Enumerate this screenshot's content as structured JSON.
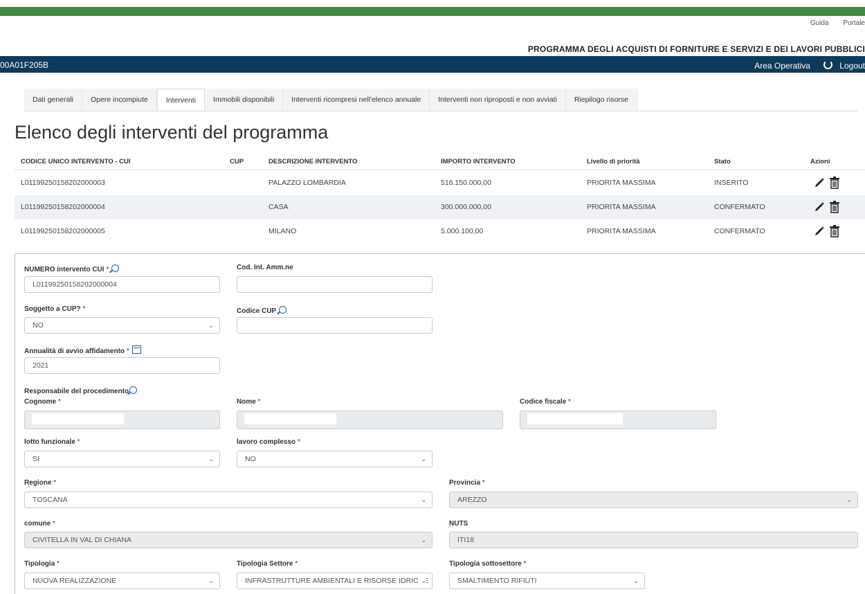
{
  "util_links": {
    "guida": "Guida",
    "portale": "Portale"
  },
  "header": {
    "program_title": "PROGRAMMA DEGLI ACQUISTI DI FORNITURE E SERVIZI E DEI LAVORI PUBBLICI"
  },
  "navbar": {
    "code": "00A01F205B",
    "area": "Area Operativa",
    "logout": "Logout"
  },
  "tabs": [
    {
      "label": "Dati generali"
    },
    {
      "label": "Opere incompiute"
    },
    {
      "label": "Interventi",
      "active": true
    },
    {
      "label": "Immobili disponibili"
    },
    {
      "label": "Interventi ricompresi nell'elenco annuale"
    },
    {
      "label": "Interventi non riproposti e non avviati"
    },
    {
      "label": "Riepilogo risorse"
    }
  ],
  "page_title": "Elenco degli interventi del programma",
  "table": {
    "headers": {
      "cui": "CODICE UNICO INTERVENTO - CUI",
      "cup": "CUP",
      "descrizione": "DESCRIZIONE INTERVENTO",
      "importo": "IMPORTO INTERVENTO",
      "priorita": "Livello di priorità",
      "stato": "Stato",
      "azioni": "Azioni"
    },
    "rows": [
      {
        "cui": "L01199250158202000003",
        "cup": "",
        "descrizione": "PALAZZO LOMBARDIA",
        "importo": "516.150.000,00",
        "priorita": "PRIORITA MASSIMA",
        "stato": "INSERITO"
      },
      {
        "cui": "L01199250158202000004",
        "cup": "",
        "descrizione": "CASA",
        "importo": "300.000.000,00",
        "priorita": "PRIORITA MASSIMA",
        "stato": "CONFERMATO"
      },
      {
        "cui": "L01199250158202000005",
        "cup": "",
        "descrizione": "MILANO",
        "importo": "5.000.100,00",
        "priorita": "PRIORITA MASSIMA",
        "stato": "CONFERMATO"
      }
    ]
  },
  "form": {
    "numero_cui": {
      "label": "NUMERO intervento CUI",
      "required": "*",
      "value": "L01199250158202000004"
    },
    "cod_int": {
      "label": "Cod. Int. Amm.ne",
      "value": ""
    },
    "soggetto_cup": {
      "label": "Soggetto a CUP?",
      "required": "*",
      "value": "NO"
    },
    "codice_cup": {
      "label": "Codice CUP",
      "value": ""
    },
    "annualita": {
      "label": "Annualità di avvio affidamento",
      "required": "*",
      "value": "2021"
    },
    "responsabile": {
      "label": "Responsabile del procedimento"
    },
    "cognome": {
      "label": "Cognome",
      "required": "*",
      "value": ""
    },
    "nome": {
      "label": "Nome",
      "required": "*",
      "value": ""
    },
    "codice_fiscale": {
      "label": "Codice fiscale",
      "required": "*",
      "value": ""
    },
    "lotto": {
      "label": "lotto funzionale",
      "required": "*",
      "value": "SI"
    },
    "lavoro": {
      "label": "lavoro complesso",
      "required": "*",
      "value": "NO"
    },
    "regione": {
      "label": "Regione",
      "required": "*",
      "value": "TOSCANA"
    },
    "provincia": {
      "label": "Provincia",
      "required": "*",
      "value": "AREZZO"
    },
    "comune": {
      "label": "comune",
      "required": "*",
      "value": "CIVITELLA IN VAL DI CHIANA"
    },
    "nuts": {
      "label": "NUTS",
      "value": "ITI18"
    },
    "tipologia": {
      "label": "Tipologia",
      "required": "*",
      "value": "NUOVA REALIZZAZIONE"
    },
    "tipologia_settore": {
      "label": "Tipologia Settore",
      "required": "*",
      "value": "INFRASTRUTTURE AMBIENTALI E RISORSE IDRICHE"
    },
    "tipologia_sottosettore": {
      "label": "Tipologia sottosettore",
      "required": "*",
      "value": "SMALTIMENTO RIFIUTI"
    }
  },
  "icons": {
    "edit": "pencil-icon",
    "delete": "trash-icon",
    "search": "search-icon",
    "calendar": "calendar-icon",
    "chevron": "chevron-down-icon",
    "logout": "power-icon"
  },
  "colors": {
    "green_bar": "#3f8b3f",
    "navbar": "#0e3b5c",
    "icon_blue": "#1f5fa8"
  }
}
